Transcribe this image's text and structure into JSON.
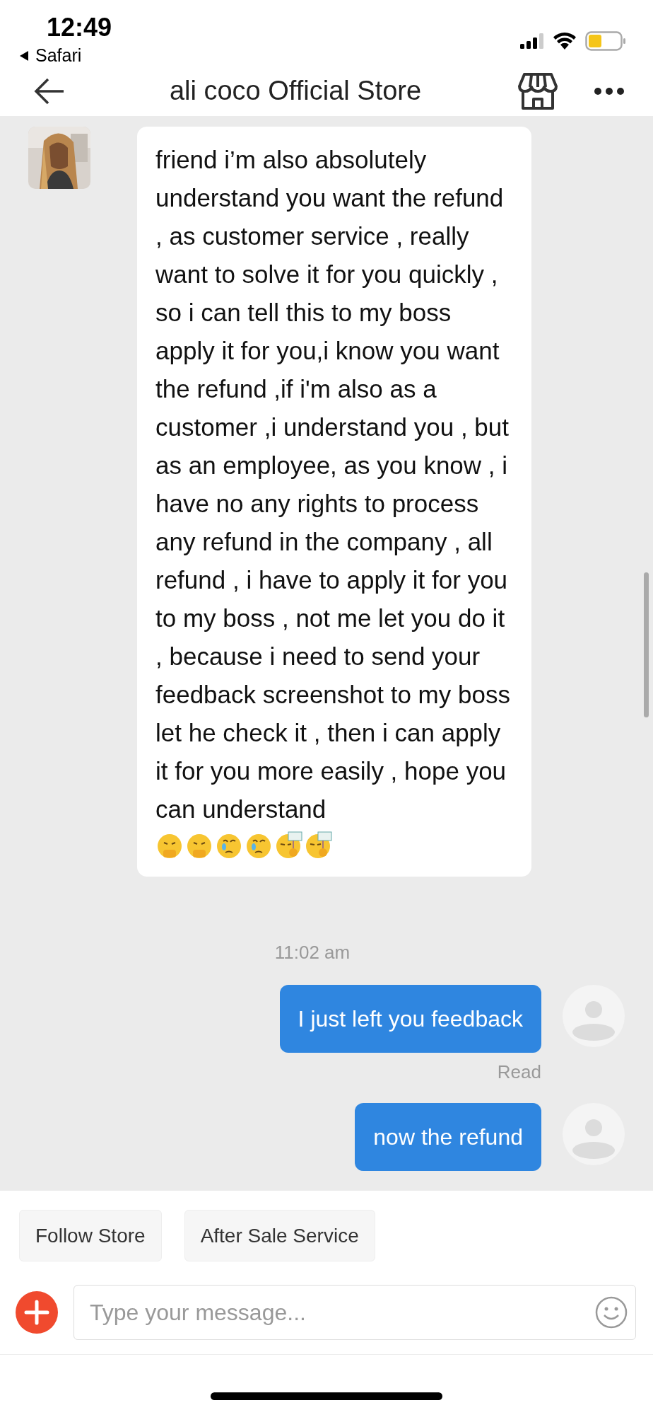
{
  "status_bar": {
    "time": "12:49",
    "back_app": "Safari"
  },
  "header": {
    "title": "ali coco Official Store"
  },
  "messages": [
    {
      "kind": "incoming",
      "text": "friend i’m also absolutely understand you want the refund , as customer service , really want to solve it for you quickly ,  so i can tell this to my boss apply it for you,i know you want the refund ,if i'm also as a customer ,i understand you , but as an employee, as you know , i have no any rights to process any refund in the company , all refund , i have to apply  it for you to my boss , not me let you do it , because i need to send  your feedback screenshot to my boss let he check it , then i can apply it for you more easily , hope you can understand",
      "emojis": [
        {
          "kind": "covering"
        },
        {
          "kind": "covering"
        },
        {
          "kind": "crying"
        },
        {
          "kind": "crying"
        },
        {
          "kind": "sign"
        },
        {
          "kind": "sign"
        }
      ]
    },
    {
      "kind": "time",
      "text": "11:02 am"
    },
    {
      "kind": "outgoing",
      "text": "I just left you feedback",
      "status": "Read"
    },
    {
      "kind": "outgoing",
      "text": "now the refund"
    }
  ],
  "quick_actions": [
    "Follow Store",
    "After Sale Service"
  ],
  "composer": {
    "placeholder": "Type your message..."
  }
}
